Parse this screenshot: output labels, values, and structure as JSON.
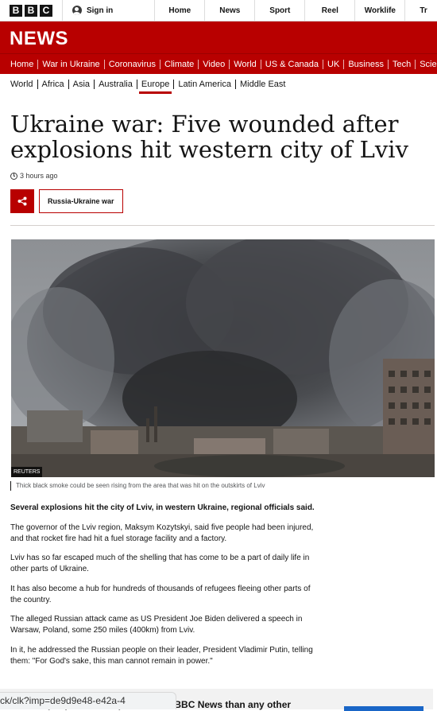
{
  "topbar": {
    "logo_letters": [
      "B",
      "B",
      "C"
    ],
    "signin_label": "Sign in",
    "nav": [
      "Home",
      "News",
      "Sport",
      "Reel",
      "Worklife",
      "Tr"
    ]
  },
  "banner": {
    "title": "NEWS"
  },
  "section_nav": [
    "Home",
    "War in Ukraine",
    "Coronavirus",
    "Climate",
    "Video",
    "World",
    "US & Canada",
    "UK",
    "Business",
    "Tech",
    "Scien"
  ],
  "sub_nav": {
    "items": [
      "World",
      "Africa",
      "Asia",
      "Australia",
      "Europe",
      "Latin America",
      "Middle East"
    ],
    "active": "Europe"
  },
  "article": {
    "headline": "Ukraine war: Five wounded after explosions hit western city of Lviv",
    "timestamp": "3 hours ago",
    "topic": "Russia-Ukraine war",
    "image_credit": "REUTERS",
    "caption": "Thick black smoke could be seen rising from the area that was hit on the outskirts of Lviv",
    "paragraphs": [
      "Several explosions hit the city of Lviv, in western Ukraine, regional officials said.",
      "The governor of the Lviv region, Maksym Kozytskyi, said five people had been injured, and that rocket fire had hit a fuel storage facility and a factory.",
      "Lviv has so far escaped much of the shelling that has come to be a part of daily life in other parts of Ukraine.",
      "It has also become a hub for hundreds of thousands of refugees fleeing other parts of the country.",
      "The alleged Russian attack came as US President Joe Biden delivered a speech in Warsaw, Poland, some 250 miles (400km) from Lviv.",
      "In it, he addressed the Russian people on their leader, President Vladimir Putin, telling them: \"For God's sake, this man cannot remain in power.\""
    ]
  },
  "trust_banner": {
    "text": "More people in more places trust BBC News than any other"
  },
  "status_url": "ck/clk?imp=de9d9e48-e42a-4",
  "colors": {
    "brand_red": "#b80000",
    "link_blue": "#1a66c7"
  }
}
